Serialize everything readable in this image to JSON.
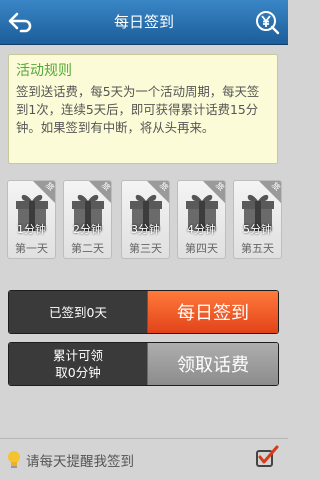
{
  "header": {
    "title": "每日签到",
    "back_icon": "back-arrow-icon",
    "right_icon": "coin-yen-icon"
  },
  "rules": {
    "title": "活动规则",
    "text": "签到送话费，每5天为一个活动周期，每天签到1次，连续5天后，即可获得累计话费15分钟。如果签到有中断，将从头再来。"
  },
  "gifts": [
    {
      "minutes": "1分钟",
      "day": "第一天",
      "corner": "旅"
    },
    {
      "minutes": "2分钟",
      "day": "第二天",
      "corner": "旅"
    },
    {
      "minutes": "3分钟",
      "day": "第三天",
      "corner": "旅"
    },
    {
      "minutes": "4分钟",
      "day": "第四天",
      "corner": "旅"
    },
    {
      "minutes": "5分钟",
      "day": "第五天",
      "corner": "旅"
    }
  ],
  "signin": {
    "status": "已签到0天",
    "button": "每日签到"
  },
  "claim": {
    "status": "累计可领\n取0分钟",
    "button": "领取话费"
  },
  "reminder": {
    "label": "请每天提醒我签到",
    "checked": true
  },
  "colors": {
    "header": "#2a71b0",
    "accent_orange": "#f05a26",
    "rules_title": "#53a83a"
  }
}
